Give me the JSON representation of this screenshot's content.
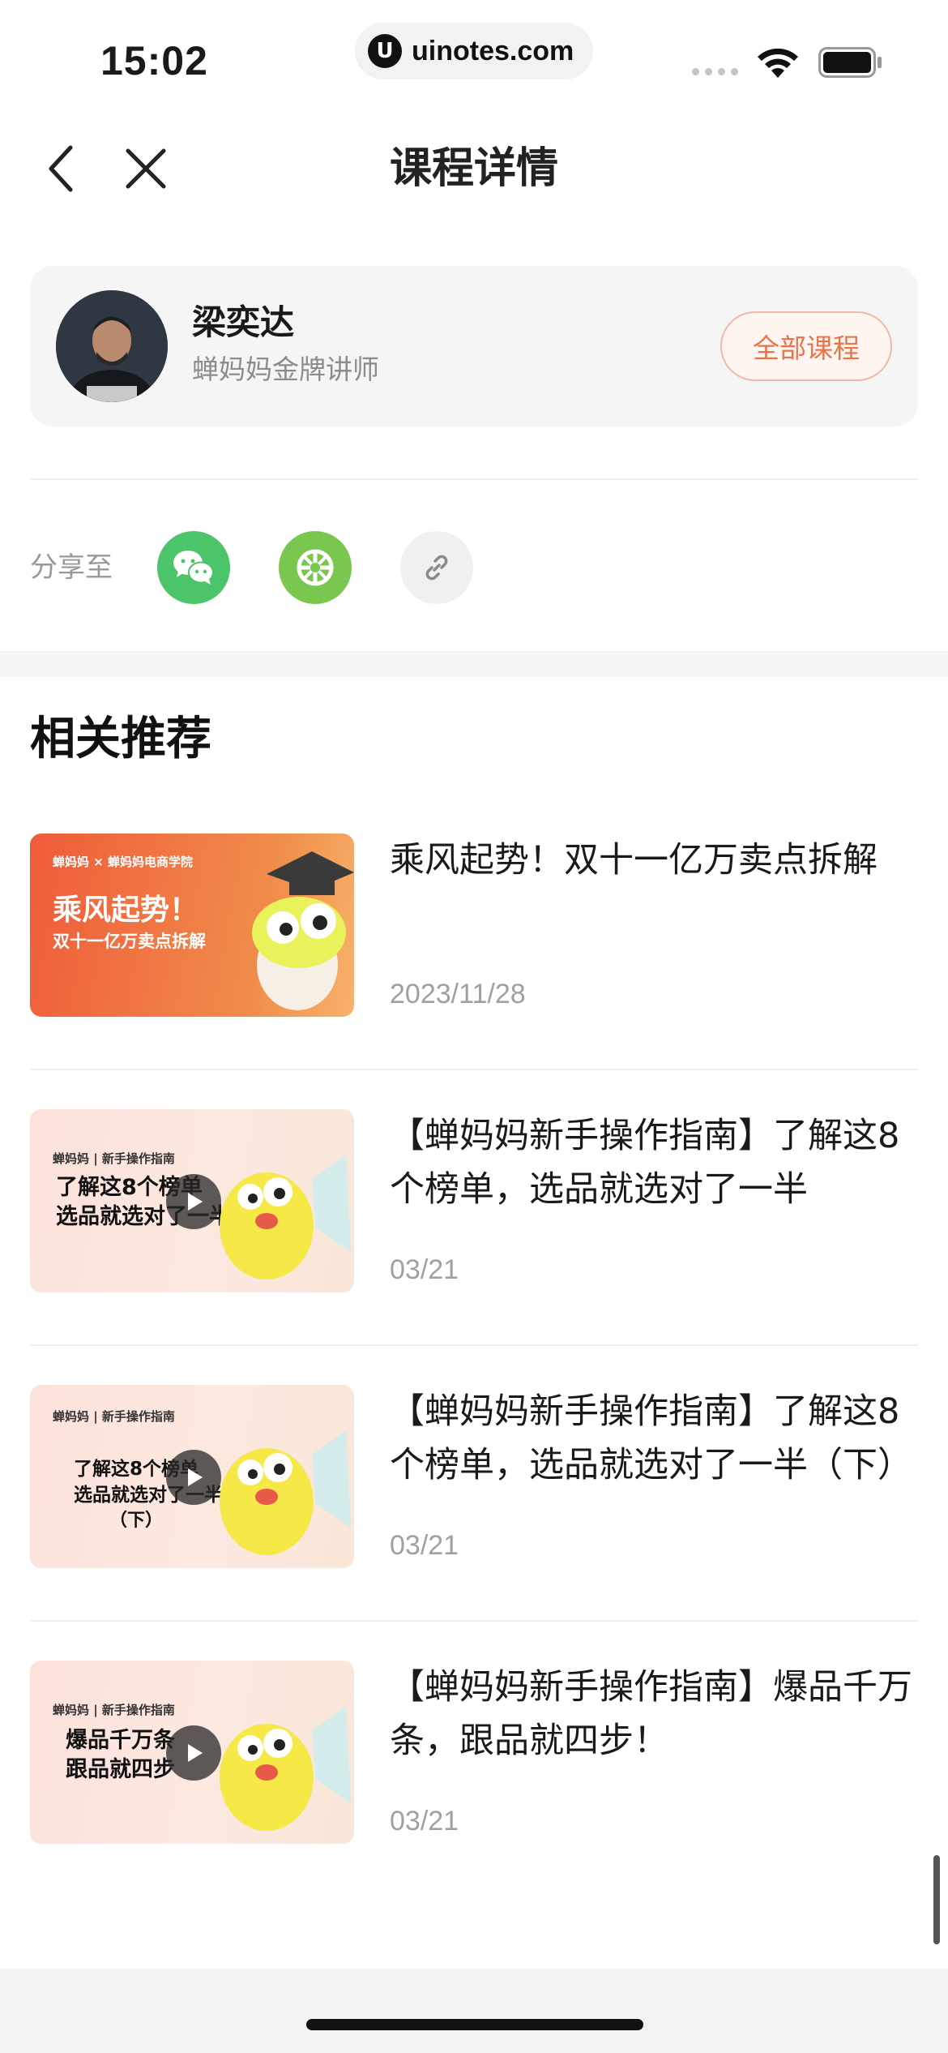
{
  "status_bar": {
    "time": "15:02",
    "url": "uinotes.com",
    "url_logo": "U"
  },
  "nav": {
    "title": "课程详情"
  },
  "teacher": {
    "name": "梁奕达",
    "title": "蝉妈妈金牌讲师",
    "all_courses_label": "全部课程"
  },
  "share": {
    "label": "分享至",
    "buttons": [
      "wechat-icon",
      "moments-icon",
      "link-icon"
    ]
  },
  "section": {
    "title": "相关推荐"
  },
  "colors": {
    "accent": "#e8744a",
    "wechat": "#4cc46a",
    "moments": "#7ac74f"
  },
  "courses": [
    {
      "title": "乘风起势！双十一亿万卖点拆解",
      "date": "2023/11/28",
      "thumb": {
        "brand": "蝉妈妈 × 蝉妈妈电商学院",
        "line1": "乘风起势！",
        "line2": "双十一亿万卖点拆解"
      }
    },
    {
      "title": "【蝉妈妈新手操作指南】了解这8个榜单，选品就选对了一半",
      "date": "03/21",
      "thumb": {
        "brand": "蝉妈妈 | 新手操作指南",
        "line1": "了解这8个榜单",
        "line2": "选品就选对了一半"
      }
    },
    {
      "title": "【蝉妈妈新手操作指南】了解这8个榜单，选品就选对了一半（下）",
      "date": "03/21",
      "thumb": {
        "brand": "蝉妈妈 | 新手操作指南",
        "line1": "了解这8个榜单",
        "line2": "选品就选对了一半",
        "line3": "（下）"
      }
    },
    {
      "title": "【蝉妈妈新手操作指南】爆品千万条，跟品就四步！",
      "date": "03/21",
      "thumb": {
        "brand": "蝉妈妈 | 新手操作指南",
        "line1": "爆品千万条",
        "line2": "跟品就四步"
      }
    }
  ]
}
